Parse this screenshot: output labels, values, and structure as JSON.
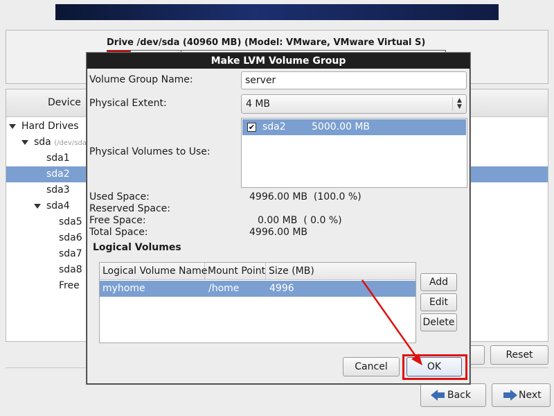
{
  "drive": {
    "title": "Drive /dev/sda (40960 MB) (Model: VMware, VMware Virtual S)"
  },
  "tree": {
    "header": "Device",
    "rows": [
      {
        "label": "Hard Drives",
        "sub": ""
      },
      {
        "label": "sda",
        "sub": "(/dev/sda)"
      },
      {
        "label": "sda1",
        "sub": ""
      },
      {
        "label": "sda2",
        "sub": ""
      },
      {
        "label": "sda3",
        "sub": ""
      },
      {
        "label": "sda4",
        "sub": ""
      },
      {
        "label": "sda5",
        "sub": ""
      },
      {
        "label": "sda6",
        "sub": ""
      },
      {
        "label": "sda7",
        "sub": ""
      },
      {
        "label": "sda8",
        "sub": ""
      },
      {
        "label": "Free",
        "sub": ""
      }
    ],
    "selected": "sda2"
  },
  "background_buttons": {
    "reset": "Reset",
    "back": "Back",
    "next": "Next"
  },
  "dialog": {
    "title": "Make LVM Volume Group",
    "vg_name_label": "Volume Group Name:",
    "vg_name_value": "server",
    "pe_label": "Physical Extent:",
    "pe_value": "4 MB",
    "pv_label": "Physical Volumes to Use:",
    "pv_items": [
      {
        "checked": true,
        "name": "sda2",
        "size": "5000.00 MB"
      }
    ],
    "used_label": "Used Space:",
    "used_value": "4996.00 MB  (100.0 %)",
    "reserved_label": "Reserved Space:",
    "free_label": "Free Space:",
    "free_value": "0.00 MB  ( 0.0 %)",
    "total_label": "Total Space:",
    "total_value": "4996.00 MB",
    "lv_section": "Logical Volumes",
    "lv_columns": [
      "Logical Volume Name",
      "Mount Point",
      "Size (MB)"
    ],
    "lv_rows": [
      {
        "name": "myhome",
        "mount": "/home",
        "size": "4996"
      }
    ],
    "add": "Add",
    "edit": "Edit",
    "delete": "Delete",
    "cancel": "Cancel",
    "ok": "OK"
  },
  "colors": {
    "selection": "#7b9fd0",
    "annotation": "#e01010",
    "title_bar": "#1f1f1f"
  }
}
